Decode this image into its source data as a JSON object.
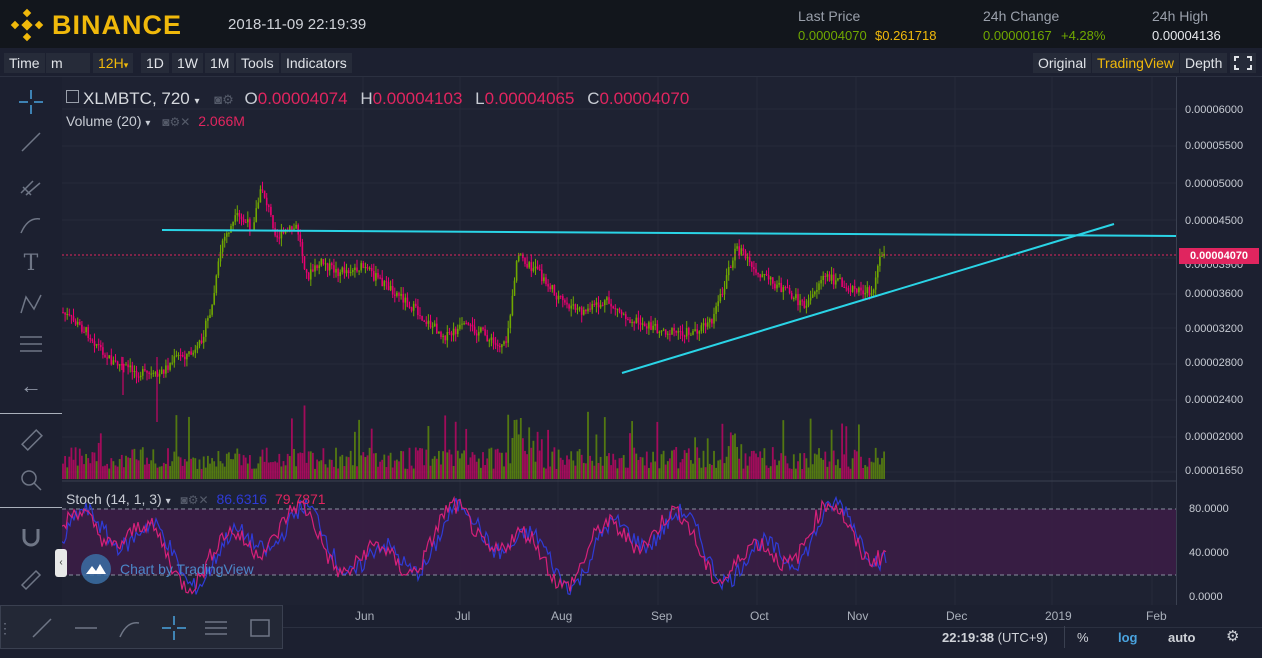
{
  "header": {
    "brand": "BINANCE",
    "datetime": "2018-11-09 22:19:39",
    "last_price_label": "Last Price",
    "last_price_btc": "0.00004070",
    "last_price_usd": "$0.261718",
    "change_label": "24h Change",
    "change_abs": "0.00000167",
    "change_pct": "+4.28%",
    "high_label": "24h High",
    "high_val": "0.00004136"
  },
  "toolbar": {
    "time": "Time",
    "minute": "m",
    "interval": "12H",
    "d1": "1D",
    "w1": "1W",
    "m1": "1M",
    "tools": "Tools",
    "indicators": "Indicators",
    "original": "Original",
    "tradingview": "TradingView",
    "depth": "Depth"
  },
  "legend": {
    "symbol": "XLMBTC, 720",
    "o_label": "O",
    "o_val": "0.00004074",
    "h_label": "H",
    "h_val": "0.00004103",
    "l_label": "L",
    "l_val": "0.00004065",
    "c_label": "C",
    "c_val": "0.00004070",
    "volume_label": "Volume (20)",
    "volume_val": "2.066M",
    "stoch_label": "Stoch (14, 1, 3)",
    "stoch_k": "86.6316",
    "stoch_d": "79.7871"
  },
  "price_axis": [
    "0.00006000",
    "0.00005500",
    "0.00005000",
    "0.00004500",
    "0.00003900",
    "0.00003600",
    "0.00003200",
    "0.00002800",
    "0.00002400",
    "0.00002000",
    "0.00001650"
  ],
  "current_price_tag": "0.00004070",
  "stoch_axis": [
    "80.0000",
    "40.0000",
    "0.0000"
  ],
  "time_axis": [
    "Jun",
    "Jul",
    "Aug",
    "Sep",
    "Oct",
    "Nov",
    "Dec",
    "2019",
    "Feb"
  ],
  "watermark": "Chart by TradingView",
  "status": {
    "clock": "22:19:38",
    "tz": "(UTC+9)",
    "pct": "%",
    "log": "log",
    "auto": "auto"
  },
  "colors": {
    "brand": "#f0b90b",
    "up": "#70a800",
    "down": "#ea0070",
    "trendline": "#2ad4e6",
    "stoch_k": "#2f3bd6",
    "stoch_d": "#d6207a"
  }
}
